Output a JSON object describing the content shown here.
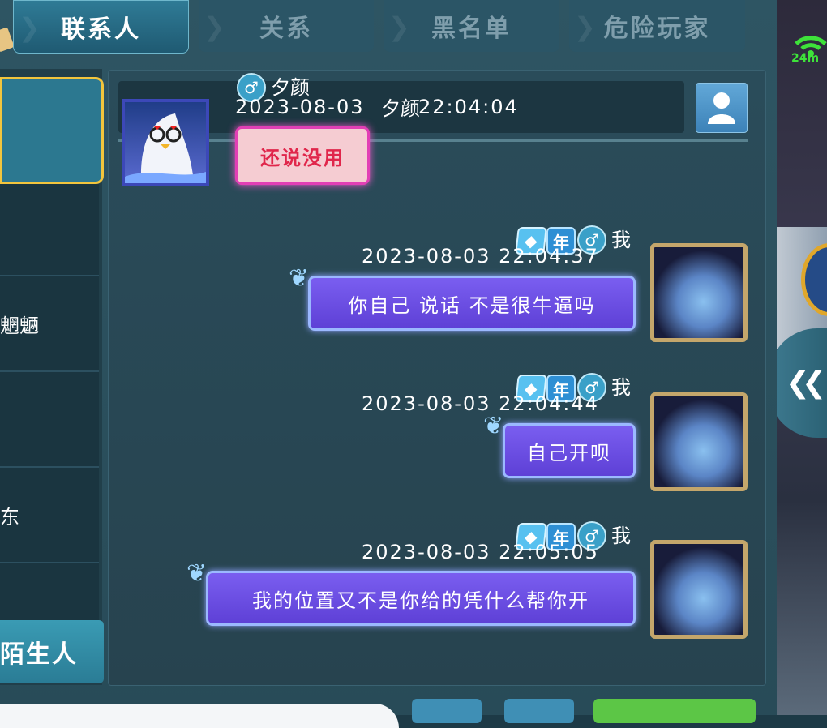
{
  "tabs": {
    "contacts": "联系人",
    "relations": "关系",
    "blacklist": "黑名单",
    "danger_players": "危险玩家"
  },
  "contacts": [
    {
      "label": ""
    },
    {
      "label": ""
    },
    {
      "label": "魍魉"
    },
    {
      "label": ""
    },
    {
      "label": "东"
    },
    {
      "label": ""
    }
  ],
  "strangers_tab": "陌生人",
  "status": {
    "ping": "24m"
  },
  "chat": {
    "peer_name": "夕颜",
    "header_timestamp": "2023-08-03",
    "header_name_overlay": "夕颜",
    "header_time": "22:04:04",
    "peer_message": "还说没用",
    "self_name": "我",
    "year_badge": "年",
    "messages": [
      {
        "timestamp": "2023-08-03  22:04:37",
        "text": "你自己 说话  不是很牛逼吗"
      },
      {
        "timestamp": "2023-08-03  22:04:44",
        "text": "自己开呗"
      },
      {
        "timestamp": "2023-08-03  22:05:05",
        "text": "我的位置又不是你给的凭什么帮你开"
      }
    ]
  },
  "colors": {
    "panel": "#2e5563",
    "active_tab": "#2f7b96",
    "bubble_mine": "#6b4fe6",
    "peer_bubble_fill": "#f5ccd2",
    "peer_bubble_text": "#e0264b",
    "selected_border": "#f2c53d",
    "send_button": "#5cc646"
  },
  "icons": [
    "gender-male-icon",
    "profile-icon",
    "diamond-vip-icon",
    "year-badge-icon",
    "wifi-icon",
    "collapse-chevron-icon"
  ]
}
